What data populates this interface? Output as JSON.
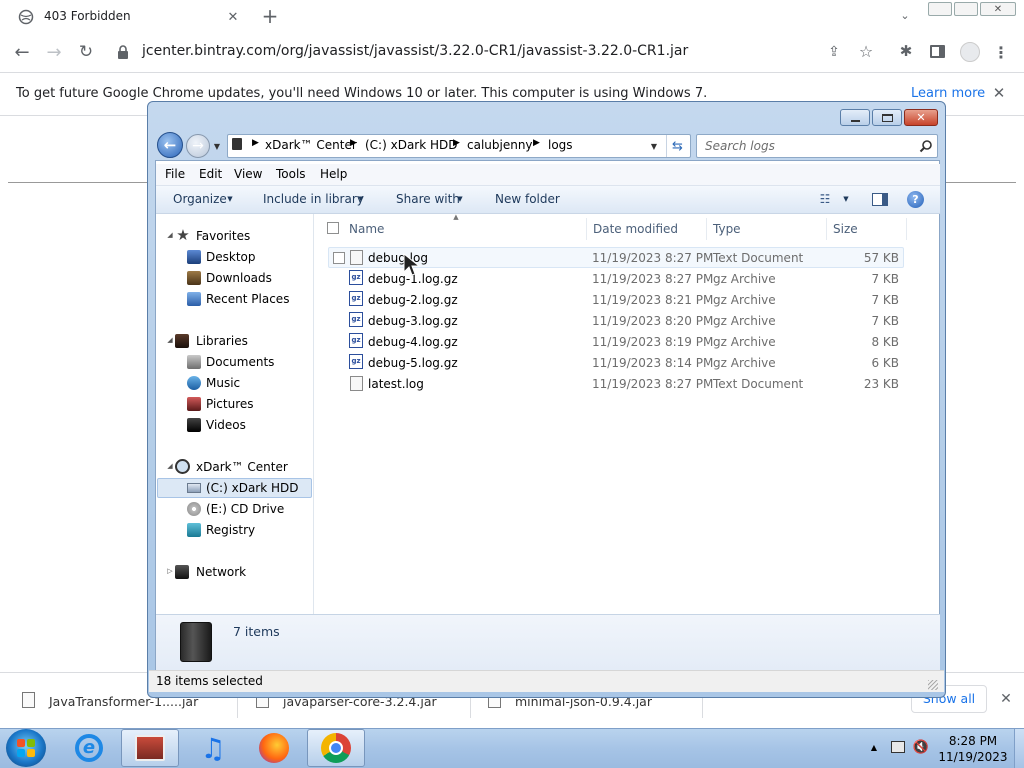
{
  "browser": {
    "tab_title": "403 Forbidden",
    "url": "jcenter.bintray.com/org/javassist/javassist/3.22.0-CR1/javassist-3.22.0-CR1.jar",
    "infobar_message": "To get future Google Chrome updates, you'll need Windows 10 or later. This computer is using Windows 7.",
    "learn_more": "Learn more"
  },
  "explorer": {
    "breadcrumb": [
      "xDark™ Center",
      "(C:) xDark HDD",
      "calubjenny",
      "logs"
    ],
    "search_placeholder": "Search logs",
    "menu": [
      "File",
      "Edit",
      "View",
      "Tools",
      "Help"
    ],
    "toolbar": {
      "organize": "Organize",
      "include_in_library": "Include in library",
      "share_with": "Share with",
      "new_folder": "New folder"
    },
    "nav": {
      "favorites": "Favorites",
      "desktop": "Desktop",
      "downloads": "Downloads",
      "recent_places": "Recent Places",
      "libraries": "Libraries",
      "documents": "Documents",
      "music": "Music",
      "pictures": "Pictures",
      "videos": "Videos",
      "computer": "xDark™ Center",
      "c_drive": "(C:) xDark HDD",
      "e_drive": "(E:) CD Drive",
      "registry": "Registry",
      "network": "Network"
    },
    "columns": [
      "Name",
      "Date modified",
      "Type",
      "Size"
    ],
    "files": [
      {
        "name": "debug.log",
        "date": "11/19/2023 8:27 PM",
        "type": "Text Document",
        "size": "57 KB",
        "icon": "text-file-icon"
      },
      {
        "name": "debug-1.log.gz",
        "date": "11/19/2023 8:27 PM",
        "type": "gz Archive",
        "size": "7 KB",
        "icon": "archive-file-icon"
      },
      {
        "name": "debug-2.log.gz",
        "date": "11/19/2023 8:21 PM",
        "type": "gz Archive",
        "size": "7 KB",
        "icon": "archive-file-icon"
      },
      {
        "name": "debug-3.log.gz",
        "date": "11/19/2023 8:20 PM",
        "type": "gz Archive",
        "size": "7 KB",
        "icon": "archive-file-icon"
      },
      {
        "name": "debug-4.log.gz",
        "date": "11/19/2023 8:19 PM",
        "type": "gz Archive",
        "size": "8 KB",
        "icon": "archive-file-icon"
      },
      {
        "name": "debug-5.log.gz",
        "date": "11/19/2023 8:14 PM",
        "type": "gz Archive",
        "size": "6 KB",
        "icon": "archive-file-icon"
      },
      {
        "name": "latest.log",
        "date": "11/19/2023 8:27 PM",
        "type": "Text Document",
        "size": "23 KB",
        "icon": "text-file-icon"
      }
    ],
    "item_count": "7 items",
    "status": "18 items selected"
  },
  "downloads": {
    "items": [
      "JavaTransformer-1.....jar",
      "javaparser-core-3.2.4.jar",
      "minimal-json-0.9.4.jar"
    ],
    "show_all": "Show all"
  },
  "taskbar": {
    "time": "8:28 PM",
    "date": "11/19/2023"
  }
}
